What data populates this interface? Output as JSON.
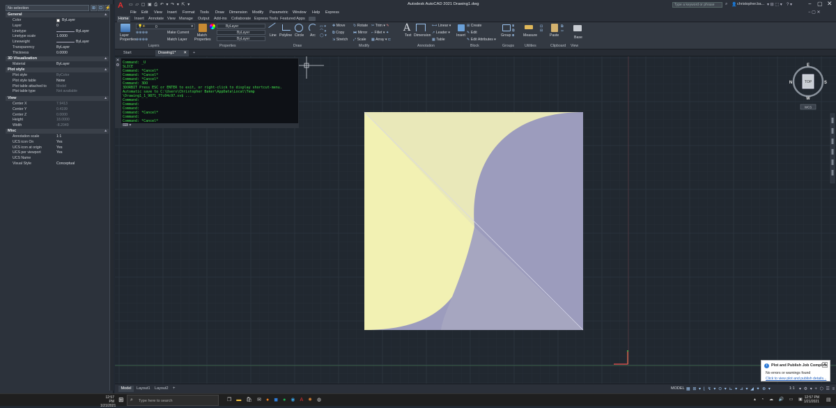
{
  "app": {
    "title": "Autodesk AutoCAD 2021   Drawing1.dwg",
    "search_placeholder": "Type a keyword or phrase",
    "user": "christopher.ba..."
  },
  "properties": {
    "selection": "No selection",
    "sections": {
      "general": "General",
      "viz3d": "3D Visualization",
      "plotstyle": "Plot style",
      "view": "View",
      "misc": "Misc"
    },
    "general": [
      {
        "k": "Color",
        "v": "ByLayer"
      },
      {
        "k": "Layer",
        "v": "0"
      },
      {
        "k": "Linetype",
        "v": "ByLayer"
      },
      {
        "k": "Linetype scale",
        "v": "1.0000"
      },
      {
        "k": "Lineweight",
        "v": "ByLayer"
      },
      {
        "k": "Transparency",
        "v": "ByLayer"
      },
      {
        "k": "Thickness",
        "v": "0.0000"
      }
    ],
    "viz3d": [
      {
        "k": "Material",
        "v": "ByLayer"
      }
    ],
    "plotstyle": [
      {
        "k": "Plot style",
        "v": "ByColor"
      },
      {
        "k": "Plot style table",
        "v": "None"
      },
      {
        "k": "Plot table attached to",
        "v": "Model"
      },
      {
        "k": "Plot table type",
        "v": "Not available"
      }
    ],
    "view": [
      {
        "k": "Center X",
        "v": "7.9413"
      },
      {
        "k": "Center Y",
        "v": "0.4199"
      },
      {
        "k": "Center Z",
        "v": "0.0000"
      },
      {
        "k": "Height",
        "v": "18.0000"
      },
      {
        "k": "Width",
        "v": "-8.2049"
      }
    ],
    "misc": [
      {
        "k": "Annotation scale",
        "v": "1:1"
      },
      {
        "k": "UCS icon On",
        "v": "Yes"
      },
      {
        "k": "UCS icon at origin",
        "v": "Yes"
      },
      {
        "k": "UCS per viewport",
        "v": "Yes"
      },
      {
        "k": "UCS Name",
        "v": ""
      },
      {
        "k": "Visual Style",
        "v": "Conceptual"
      }
    ]
  },
  "menu": [
    "File",
    "Edit",
    "View",
    "Insert",
    "Format",
    "Tools",
    "Draw",
    "Dimension",
    "Modify",
    "Parametric",
    "Window",
    "Help",
    "Express"
  ],
  "ribbon_tabs": [
    "Home",
    "Insert",
    "Annotate",
    "View",
    "Manage",
    "Output",
    "Add-ins",
    "Collaborate",
    "Express Tools",
    "Featured Apps"
  ],
  "ribbon": {
    "layer_properties": "Layer Properties",
    "layer_name": "0",
    "make_current": "Make Current",
    "match_layer": "Match Layer",
    "match_properties": "Match Properties",
    "bylayer": "ByLayer",
    "draw": [
      "Line",
      "Polyline",
      "Circle",
      "Arc"
    ],
    "modify": [
      "Move",
      "Rotate",
      "Trim",
      "Copy",
      "Mirror",
      "Fillet",
      "Stretch",
      "Scale",
      "Array"
    ],
    "text": "Text",
    "dimension": "Dimension",
    "linear": "Linear",
    "leader": "Leader",
    "table": "Table",
    "insert": "Insert",
    "create": "Create",
    "edit": "Edit",
    "edit_attributes": "Edit Attributes",
    "group": "Group",
    "measure": "Measure",
    "paste": "Paste",
    "base": "Base",
    "panels": [
      "Layers",
      "Properties",
      "Draw",
      "Modify",
      "Annotation",
      "Block",
      "Groups",
      "Utilities",
      "Clipboard",
      "View"
    ]
  },
  "doc_tabs": [
    "Start",
    "Drawing1*"
  ],
  "command_history": [
    "Command: _U",
    "SLICE",
    "Command: *Cancel*",
    "Command: *Cancel*",
    "Command: *Cancel*",
    "Command: 3DO",
    "3DORBIT Press ESC or ENTER to exit, or right-click to display shortcut-menu.",
    "Automatic save to C:\\Users\\Christopher Baker\\AppData\\Local\\Temp",
    "\\Drawing1_1_9871_77c04c97.sv$ ...",
    "Command:",
    "Command:",
    "Command:",
    "Command: *Cancel*",
    "Command:",
    "Command: *Cancel*"
  ],
  "viewcube": {
    "top": "TOP",
    "n": "N",
    "s": "S",
    "e": "E",
    "w": "W",
    "wcs": "WCS"
  },
  "layout_tabs": [
    "Model",
    "Layout1",
    "Layout2"
  ],
  "status": {
    "model": "MODEL",
    "scale": "1:1"
  },
  "notification": {
    "title": "Plot and Publish Job Complete",
    "body": "No errors or warnings found",
    "link": "Click to view plot and publish details..."
  },
  "taskbar": {
    "time": "12:57 PM",
    "date": "1/21/2021",
    "search_placeholder": "Type here to search",
    "time2": "12:57 PM",
    "date2": "1/21/2021"
  },
  "colors": {
    "yellow_face": "#f2f1b3",
    "purple_face": "#9c9cbd",
    "lavender_face": "#a6a6c0",
    "pale_face": "#e9e8b9",
    "viewport_bg": "#212830",
    "command_text": "#3fe04a",
    "accent": "#2f7bd6"
  }
}
